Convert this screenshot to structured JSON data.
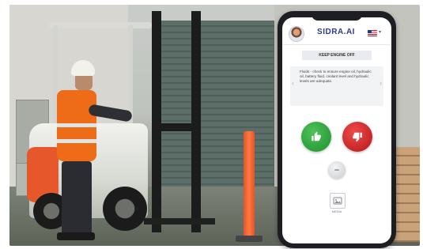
{
  "app": {
    "logo_text": "SIDRA.AI",
    "language_flag": "us-flag-icon",
    "step_title": "KEEP ENGINE OFF",
    "instruction": "Fluids - check to ensure engine oil, hydraulic oil, battery fluid, coolant level and hydraulic levels are adequate.",
    "media_label": "MEDIA",
    "icons": {
      "thumbs_up": "thumbs-up-icon",
      "thumbs_down": "thumbs-down-icon",
      "neutral": "neutral-icon",
      "media": "image-icon",
      "prev": "chevron-left-icon",
      "next": "chevron-right-icon"
    },
    "colors": {
      "approve": "#2eaa3e",
      "reject": "#d12525",
      "brand": "#2b3a8f"
    }
  }
}
